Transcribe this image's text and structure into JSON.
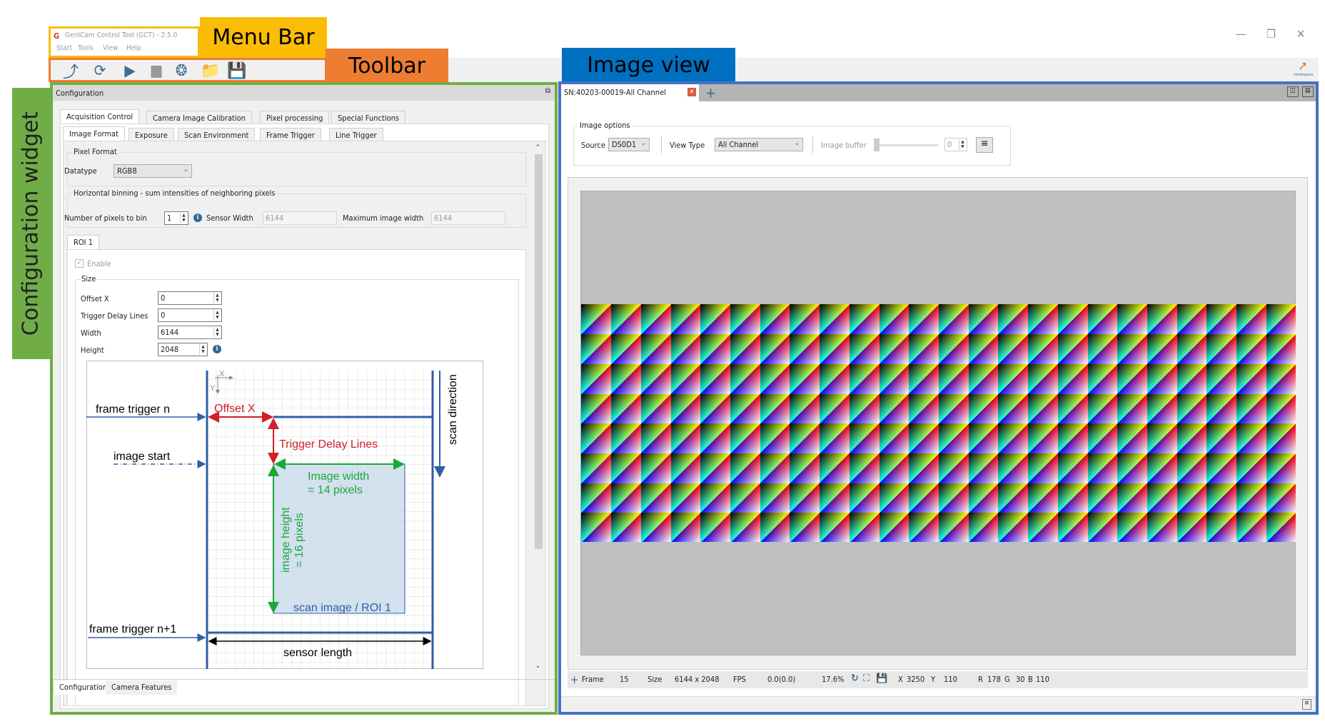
{
  "annotations": {
    "menu_bar": "Menu Bar",
    "toolbar": "Toolbar",
    "image_view": "Image view",
    "config_widget": "Configuration widget"
  },
  "colors": {
    "menu_bar": "#fbbc05",
    "toolbar": "#ed7d31",
    "image_view": "#0070c0",
    "config_widget": "#70ad47",
    "icon_blue": "#3d6d8f"
  },
  "window": {
    "title": "GenICam Control Tool (GCT) - 2.5.0",
    "menus": [
      "Start",
      "Tools",
      "View",
      "Help"
    ],
    "controls": [
      "minimize-icon",
      "restore-icon",
      "close-icon"
    ],
    "logo": "chromasens"
  },
  "toolbar": {
    "icons": [
      "connect-plug-icon",
      "refresh-icon",
      "start-video-icon",
      "stop-video-icon",
      "snapshot-aperture-icon",
      "open-folder-icon",
      "save-icon"
    ]
  },
  "config": {
    "title": "Configuration",
    "tabs_top": [
      "Acquisition Control",
      "Camera Image Calibration",
      "Pixel processing",
      "Special Functions"
    ],
    "tabs_sub": [
      "Image Format",
      "Exposure",
      "Scan Environment",
      "Frame Trigger",
      "Line Trigger"
    ],
    "pixel_format": {
      "title": "Pixel Format",
      "datatype_label": "Datatype",
      "datatype_value": "RGB8"
    },
    "binning": {
      "title": "Horizontal binning - sum intensities of neighboring pixels",
      "bin_label": "Number of pixels to bin",
      "bin_value": "1",
      "sensor_width_label": "Sensor Width",
      "sensor_width_value": "6144",
      "max_width_label": "Maximum image width",
      "max_width_value": "6144"
    },
    "roi": {
      "tab": "ROI 1",
      "enable_label": "Enable",
      "enabled": true,
      "size_title": "Size",
      "fields": [
        {
          "label": "Offset X",
          "value": "0"
        },
        {
          "label": "Trigger Delay Lines",
          "value": "0"
        },
        {
          "label": "Width",
          "value": "6144"
        },
        {
          "label": "Height",
          "value": "2048"
        }
      ]
    },
    "diagram": {
      "frame_trigger_n": "frame trigger n",
      "image_start": "image start",
      "frame_trigger_n1": "frame trigger n+1",
      "offset_x": "Offset X",
      "trigger_delay": "Trigger Delay Lines",
      "image_width_1": "Image width",
      "image_width_2": "= 14 pixels",
      "image_height_1": "image height",
      "image_height_2": "= 16 pixels",
      "roi_label": "scan image / ROI 1",
      "sensor_length": "sensor length",
      "scan_direction": "scan direction",
      "axis_x": "X",
      "axis_y": "Y"
    },
    "bottom_tabs": [
      "Configuration",
      "Camera Features"
    ]
  },
  "image_view": {
    "tab_label": "SN:40203-00019-All Channel",
    "options": {
      "title": "Image options",
      "source_label": "Source",
      "source_value": "DS0D1",
      "view_type_label": "View Type",
      "view_type_value": "All Channel",
      "buffer_label": "Image buffer",
      "buffer_value": "0",
      "buffer_level": 0
    },
    "status": {
      "frame_label": "Frame",
      "frame_value": "15",
      "size_label": "Size",
      "size_value": "6144 x 2048",
      "fps_label": "FPS",
      "fps_value": "0.0(0.0)",
      "zoom_value": "17.6%",
      "x_label": "X",
      "x_value": "3250",
      "y_label": "Y",
      "y_value": "110",
      "r_label": "R",
      "r_value": "178",
      "g_label": "G",
      "g_value": "30",
      "b_label": "B",
      "b_value": "110"
    }
  }
}
